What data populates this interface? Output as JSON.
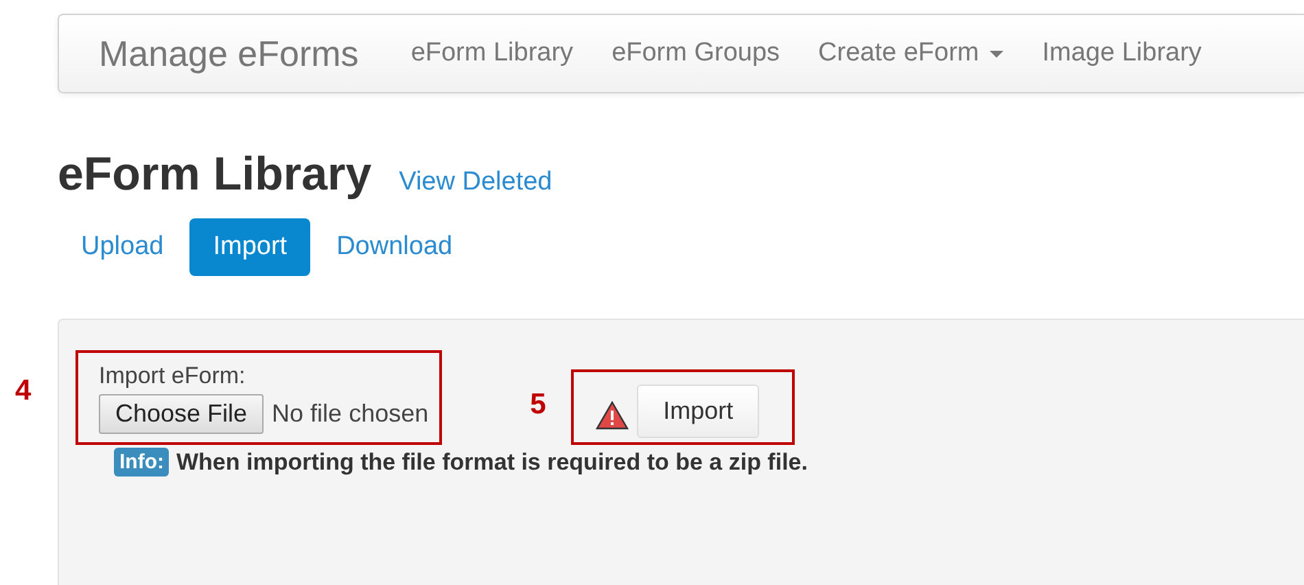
{
  "navbar": {
    "brand": "Manage eForms",
    "items": [
      {
        "label": "eForm Library",
        "dropdown": false
      },
      {
        "label": "eForm Groups",
        "dropdown": false
      },
      {
        "label": "Create eForm",
        "dropdown": true
      },
      {
        "label": "Image Library",
        "dropdown": false
      }
    ]
  },
  "heading": {
    "title": "eForm Library",
    "link": "View Deleted"
  },
  "tabs": [
    {
      "label": "Upload",
      "selected": false
    },
    {
      "label": "Import",
      "selected": true
    },
    {
      "label": "Download",
      "selected": false
    }
  ],
  "panel": {
    "file_callout": "4",
    "file_label": "Import eForm:",
    "choose_button": "Choose File",
    "file_status": "No file chosen",
    "import_callout": "5",
    "import_button": "Import",
    "info_badge": "Info:",
    "info_text": "When importing the file format is required to be a zip file."
  }
}
